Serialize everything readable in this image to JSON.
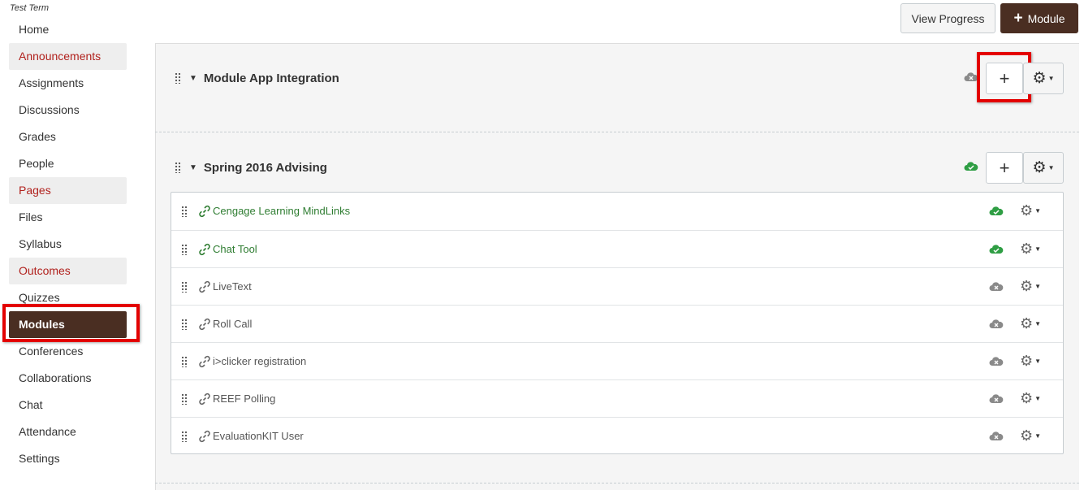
{
  "sidebar": {
    "term": "Test Term",
    "items": [
      {
        "label": "Home",
        "style": "normal"
      },
      {
        "label": "Announcements",
        "style": "hl"
      },
      {
        "label": "Assignments",
        "style": "normal"
      },
      {
        "label": "Discussions",
        "style": "normal"
      },
      {
        "label": "Grades",
        "style": "normal"
      },
      {
        "label": "People",
        "style": "normal"
      },
      {
        "label": "Pages",
        "style": "hl"
      },
      {
        "label": "Files",
        "style": "normal"
      },
      {
        "label": "Syllabus",
        "style": "normal"
      },
      {
        "label": "Outcomes",
        "style": "hl"
      },
      {
        "label": "Quizzes",
        "style": "normal"
      },
      {
        "label": "Modules",
        "style": "active"
      },
      {
        "label": "Conferences",
        "style": "normal"
      },
      {
        "label": "Collaborations",
        "style": "normal"
      },
      {
        "label": "Chat",
        "style": "normal"
      },
      {
        "label": "Attendance",
        "style": "normal"
      },
      {
        "label": "Settings",
        "style": "normal"
      }
    ]
  },
  "toolbar": {
    "view_progress_label": "View Progress",
    "add_module_label": "Module"
  },
  "modules": [
    {
      "title": "Module App Integration",
      "published": false
    },
    {
      "title": "Spring 2016 Advising",
      "published": true
    }
  ],
  "items": [
    {
      "title": "Cengage Learning MindLinks",
      "published": true
    },
    {
      "title": "Chat Tool",
      "published": true
    },
    {
      "title": "LiveText",
      "published": false
    },
    {
      "title": "Roll Call",
      "published": false
    },
    {
      "title": "i>clicker registration",
      "published": false
    },
    {
      "title": "REEF Polling",
      "published": false
    },
    {
      "title": "EvaluationKIT User",
      "published": false
    }
  ],
  "colors": {
    "published": "#2f9e44",
    "unpublished": "#8a8a8a",
    "active_nav": "#4a2e22",
    "highlight_text": "#b1211d",
    "annotation": "#e30000"
  },
  "icons": {
    "drag": "drag-handle-icon",
    "caret": "caret-down-icon",
    "link": "link-icon",
    "gear": "gear-icon",
    "cloud_published": "cloud-check-icon",
    "cloud_unpublished": "cloud-x-icon"
  }
}
